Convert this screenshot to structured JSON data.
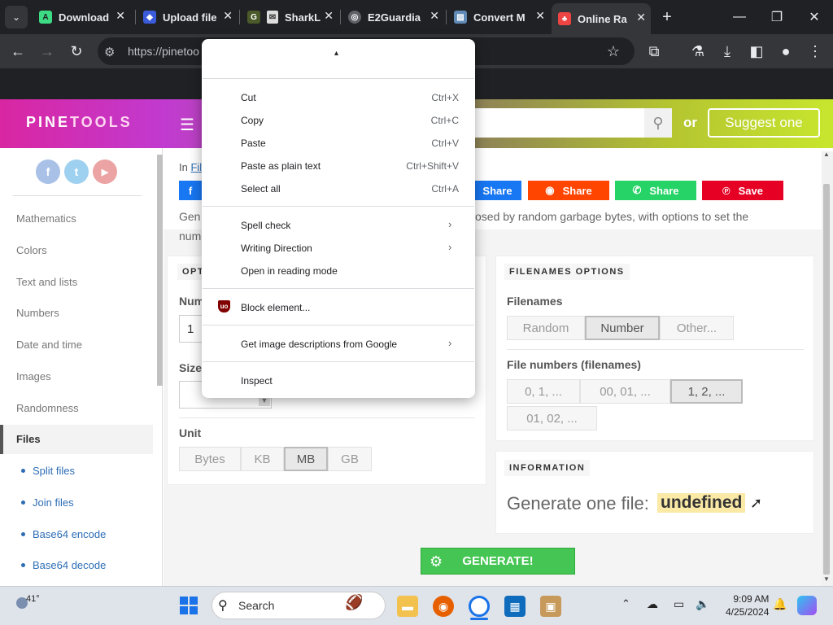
{
  "browser": {
    "tabs": [
      {
        "label": "Download",
        "icon": "android-icon",
        "color": "#3ddc84",
        "active": false
      },
      {
        "label": "Upload file",
        "icon": "upload-icon",
        "color": "#3b5bdb",
        "active": false
      },
      {
        "label": "SharkL",
        "icon": "sharklasers-icon",
        "color": "#4a5a2a",
        "active": false
      },
      {
        "label": "E2Guardia",
        "icon": "globe-icon",
        "color": "#9aa0a6",
        "active": false
      },
      {
        "label": "Convert M",
        "icon": "image-icon",
        "color": "#5f8ab5",
        "active": false
      },
      {
        "label": "Online Ra",
        "icon": "pinetools-icon",
        "color": "#e44",
        "active": true
      }
    ],
    "new_tab": "+",
    "url": "https://pinetoo",
    "window_controls": {
      "minimize": "—",
      "maximize": "❐",
      "close": "✕"
    }
  },
  "site": {
    "logo_left": "PINE",
    "logo_right": "TOOLS",
    "or_text": "or",
    "suggest_label": "Suggest one"
  },
  "sidebar": {
    "social": [
      {
        "name": "facebook",
        "glyph": "f",
        "color": "#a9c1e6"
      },
      {
        "name": "twitter",
        "glyph": "t",
        "color": "#9ed0ef"
      },
      {
        "name": "youtube",
        "glyph": "▶",
        "color": "#eba3a3"
      }
    ],
    "nav": [
      "Mathematics",
      "Colors",
      "Text and lists",
      "Numbers",
      "Date and time",
      "Images",
      "Randomness"
    ],
    "active": "Files",
    "sub": [
      "Split files",
      "Join files",
      "Base64 encode",
      "Base64 decode"
    ]
  },
  "main": {
    "breadcrumb_prefix": "In",
    "breadcrumb_link": "Fil",
    "share": [
      {
        "label": "Share",
        "color": "#1877f2"
      },
      {
        "label": "Share",
        "color": "#ff4500"
      },
      {
        "label": "Share",
        "color": "#25d366"
      },
      {
        "label": "Save",
        "color": "#e60023"
      }
    ],
    "desc_start": "Gen",
    "desc_end": "osed by random garbage bytes, with options to set the",
    "desc_line2": "num",
    "options_title": "OPT",
    "num_label": "Num",
    "num_value": "1",
    "size_label": "Size",
    "unit_label": "Unit",
    "units": [
      "Bytes",
      "KB",
      "MB",
      "GB"
    ],
    "unit_selected": "MB",
    "filenames_title": "FILENAMES OPTIONS",
    "filenames_label": "Filenames",
    "filenames_opts": [
      "Random",
      "Number",
      "Other..."
    ],
    "filenames_selected": "Number",
    "filenumbers_label": "File numbers (filenames)",
    "filenumbers_opts": [
      "0, 1, ...",
      "00, 01, ...",
      "1, 2, ...",
      "01, 02, ..."
    ],
    "filenumbers_selected": "1, 2, ...",
    "info_title": "INFORMATION",
    "info_text": "Generate one file:",
    "info_value": "undefined",
    "generate_label": "GENERATE!"
  },
  "context_menu": {
    "top_glyph": "▴",
    "items": [
      {
        "label": "Cut",
        "shortcut": "Ctrl+X"
      },
      {
        "label": "Copy",
        "shortcut": "Ctrl+C"
      },
      {
        "label": "Paste",
        "shortcut": "Ctrl+V"
      },
      {
        "label": "Paste as plain text",
        "shortcut": "Ctrl+Shift+V"
      },
      {
        "label": "Select all",
        "shortcut": "Ctrl+A"
      },
      {
        "label": "Spell check",
        "shortcut": "›"
      },
      {
        "label": "Writing Direction",
        "shortcut": "›"
      },
      {
        "label": "Open in reading mode",
        "shortcut": ""
      },
      {
        "label": "Block element...",
        "shortcut": ""
      },
      {
        "label": "Get image descriptions from Google",
        "shortcut": "›"
      },
      {
        "label": "Inspect",
        "shortcut": ""
      }
    ]
  },
  "taskbar": {
    "weather": "41°",
    "search_placeholder": "Search",
    "time": "9:09 AM",
    "date": "4/25/2024"
  }
}
